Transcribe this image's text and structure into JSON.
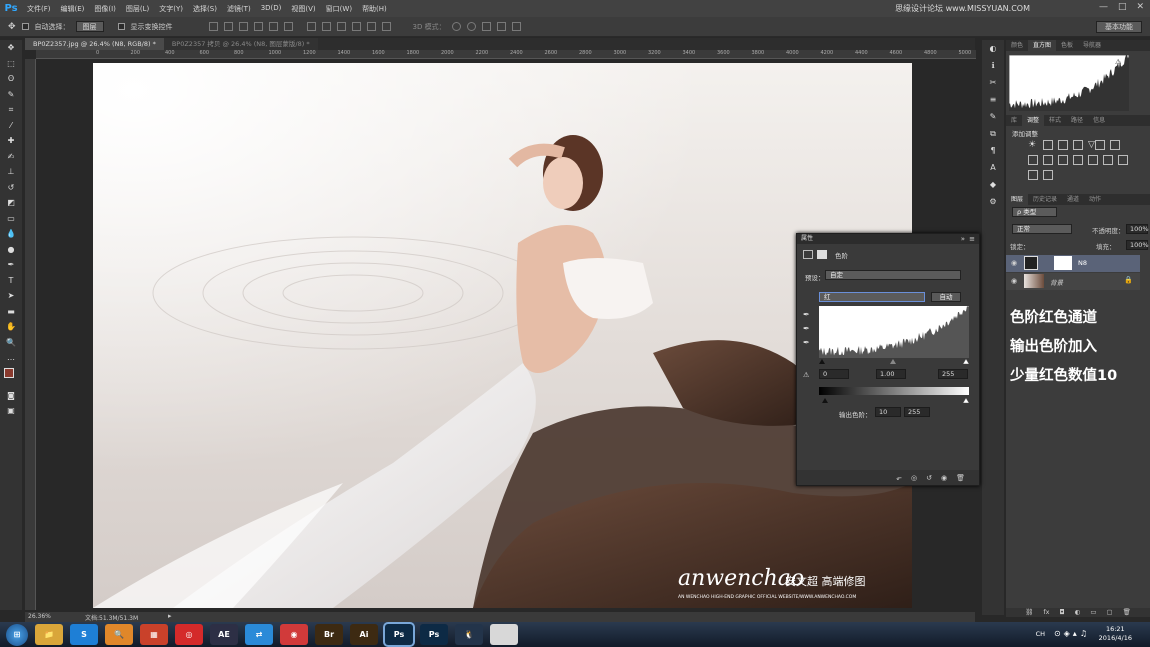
{
  "app": {
    "logo": "Ps",
    "watermark": "思缘设计论坛 www.MISSYUAN.COM",
    "window_buttons": [
      "—",
      "□",
      "✕"
    ]
  },
  "menu": [
    "文件(F)",
    "编辑(E)",
    "图像(I)",
    "图层(L)",
    "文字(Y)",
    "选择(S)",
    "滤镜(T)",
    "3D(D)",
    "视图(V)",
    "窗口(W)",
    "帮助(H)"
  ],
  "options": {
    "auto_select": "自动选择：",
    "auto_select_value": "图层",
    "show_transform": "显示变换控件",
    "mode3d": "3D 模式：",
    "workspace": "基本功能"
  },
  "tabs": [
    {
      "label": "BP0Z2357.jpg @ 26.4% (N8, RGB/8) *"
    },
    {
      "label": "BP0Z2357 拷贝 @ 26.4% (N8, 图层蒙版/8) *"
    }
  ],
  "ruler_ticks": [
    "0",
    "200",
    "400",
    "600",
    "800",
    "1000",
    "1200",
    "1400",
    "1600",
    "1800",
    "2000",
    "2200",
    "2400",
    "2600",
    "2800",
    "3000",
    "3200",
    "3400",
    "3600",
    "3800",
    "4000",
    "4200",
    "4400",
    "4600",
    "4800",
    "5000",
    "5200",
    "5400"
  ],
  "status": {
    "zoom": "26.36%",
    "doc": "文档:51.3M/51.3M"
  },
  "photo": {
    "brand": "anwenchao",
    "brand_cn": "安文超 高端修图",
    "tagline": "AN WENCHAO HIGH-END GRAPHIC OFFICIAL WEBSITE/WWW.ANWENCHAO.COM"
  },
  "properties": {
    "title": "属性",
    "adjustment": "色阶",
    "preset_label": "预设：",
    "preset_value": "自定",
    "channel": "红",
    "auto_btn": "自动",
    "input_black": "0",
    "input_gamma": "1.00",
    "input_white": "255",
    "output_label": "输出色阶：",
    "output_black": "10",
    "output_white": "255"
  },
  "right_panel": {
    "tabs_top": [
      "颜色",
      "直方图",
      "色板",
      "导航器"
    ],
    "tabs_mid": [
      "库",
      "调整",
      "样式",
      "路径",
      "信息"
    ],
    "add_adjust": "添加调整",
    "tabs_layers": [
      "图层",
      "历史记录",
      "通道",
      "动作"
    ],
    "kind": "类型",
    "blend": "正常",
    "opacity_label": "不透明度：",
    "opacity": "100%",
    "lock_label": "锁定：",
    "fill_label": "填充：",
    "fill": "100%",
    "layers": [
      {
        "name": "N8"
      },
      {
        "name": "背景"
      }
    ]
  },
  "note": [
    "色阶红色通道",
    "输出色阶加入",
    "少量红色数值10"
  ],
  "taskbar": {
    "apps": [
      {
        "name": "file-explorer",
        "text": "📁",
        "bg": "#d9a63a"
      },
      {
        "name": "sogou",
        "text": "S",
        "bg": "#1e7fd6"
      },
      {
        "name": "search",
        "text": "🔍",
        "bg": "#e0872a"
      },
      {
        "name": "office",
        "text": "▦",
        "bg": "#c9412a"
      },
      {
        "name": "netease-music",
        "text": "◎",
        "bg": "#d42a2a"
      },
      {
        "name": "after-effects",
        "text": "AE",
        "bg": "#2d2f45"
      },
      {
        "name": "transfer",
        "text": "⇄",
        "bg": "#2a8ad8"
      },
      {
        "name": "camera",
        "text": "◉",
        "bg": "#d13a3a"
      },
      {
        "name": "bridge",
        "text": "Br",
        "bg": "#3d2a12"
      },
      {
        "name": "illustrator",
        "text": "Ai",
        "bg": "#3d2a12"
      },
      {
        "name": "photoshop-active",
        "text": "Ps",
        "bg": "#0d2a45"
      },
      {
        "name": "photoshop",
        "text": "Ps",
        "bg": "#0d2a45"
      },
      {
        "name": "qq",
        "text": "🐧",
        "bg": "#23344a"
      },
      {
        "name": "window-thumb",
        "text": "",
        "bg": "#d8d8d8"
      }
    ],
    "tray_lang": "CH",
    "time": "16:21",
    "date": "2016/4/16"
  }
}
